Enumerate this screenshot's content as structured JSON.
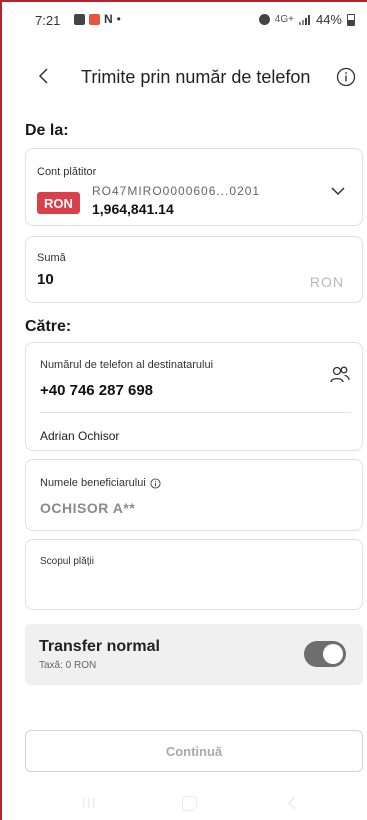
{
  "status_bar": {
    "time": "7:21",
    "notif_n": "N",
    "dot": "•",
    "network": "4G+",
    "battery": "44%"
  },
  "header": {
    "title": "Trimite prin număr de telefon"
  },
  "from_section": {
    "label": "De la:",
    "account": {
      "label": "Cont plătitor",
      "currency_badge": "RON",
      "iban": "RO47MIRO0000606...0201",
      "balance": "1,964,841.14"
    },
    "amount": {
      "label": "Sumă",
      "value": "10",
      "currency": "RON"
    }
  },
  "to_section": {
    "label": "Către:",
    "phone": {
      "label": "Numărul de telefon al destinatarului",
      "value": "+40 746 287 698",
      "contact_name": "Adrian Ochisor"
    },
    "beneficiary": {
      "label": "Numele beneficiarului",
      "value": "OCHISOR A**"
    },
    "purpose": {
      "label": "Scopul plății",
      "value": ""
    }
  },
  "transfer": {
    "title": "Transfer normal",
    "fee": "Taxă: 0 RON",
    "enabled": true
  },
  "continue_label": "Continuă",
  "colors": {
    "accent_badge": "#d9404b",
    "frame_border": "#b8232a",
    "toggle_on": "#6e6e6e"
  },
  "icons": {
    "back": "chevron-left-icon",
    "info": "info-circle-icon",
    "dropdown": "chevron-down-icon",
    "contacts": "contacts-icon"
  }
}
